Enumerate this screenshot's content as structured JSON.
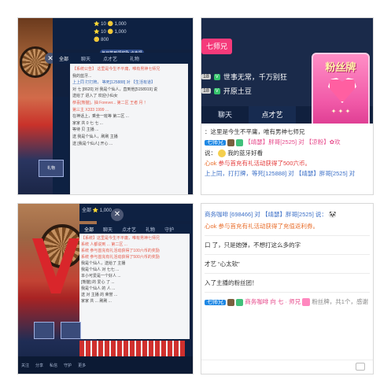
{
  "panelA": {
    "topbar": {
      "line1": "⭐  10   🪙 1,000",
      "line2": "⭐  10   🪙 1,000",
      "line3": "🪙 800"
    },
    "close": "✕",
    "promo_text": "每日签到领奖励\n点击领取",
    "tabs": [
      "全部",
      "聊天",
      "点才艺",
      "礼物"
    ],
    "chat": [
      "【系统公告】 这里是今生不平庸，唯有男神七师兄",
      "我的蓝牙...",
      "上上同 打打牌， 等死[125888] 对 【生活有道】",
      "对 七 [8620] 对 我是个仙人，直到他[5158919] 说",
      "送给了 进入了  欢迎小仙女",
      "恭喜[熊猫]，抽 Forever... 第二区 王者 月 ！",
      "第三主 X333 1999 ...",
      "在神话上，乘坐一班等 第二区 ...",
      "家家 共 0 七 七 ...",
      "等待 贝 主播 ...",
      "送 我是个仙人，刷刷 主播",
      "送 [我是个仙人] 开心 ..."
    ],
    "gift_label": "礼物"
  },
  "panelB": {
    "rank_badge": "七师兄",
    "header_lines": [
      {
        "lvl": "18",
        "text": "世事无常，千万别狂"
      },
      {
        "lvl": "18",
        "text": "开原土豆"
      }
    ],
    "tabs": [
      "聊天",
      "点才艺",
      "礼"
    ],
    "fans_title": "粉丝牌",
    "fans_stars": "✦ ✦ ✦",
    "chat": {
      "line1": "：这里是今生不平庸，唯有男神七师兄",
      "line2_tag": "七师兄",
      "line2_user": "【靖瑟】胖哥[2525] 对 【凉粉】✿欢",
      "line3": "说：",
      "line3b": "我的蓝牙好看",
      "line4_prefix": "心ok",
      "line4": "参与首充有礼活动获得了500六币。",
      "line5": "上上同，打打牌，等死[125888] 对 【靖瑟】胖哥[2525] 对"
    }
  },
  "panelC": {
    "topbar_text": "全部  ⭐  1,000",
    "close": "✕",
    "promo_text": "每日签到",
    "tabs": [
      "全部",
      "聊天",
      "点才艺",
      "礼物",
      "守护"
    ],
    "chat": [
      "【系统】这里是今生不平庸，唯有男神七师兄",
      "系统 人都说到 ... 第二区  ...",
      "系统  参与首充有礼活动获得了100六币的奖励",
      "系统  参与首充有礼活动获得了500六币的奖励",
      "我是个仙人，送给了 主播",
      "我是个仙人 对 七七 ...",
      "本小可爱是一个好人 ...",
      "[熊猫]  的 爱心 了 ...",
      "我是个仙人 的 人 ...",
      "送 对 主播 的 荣誉 ...",
      "家家 共 ... 刷刷 ..."
    ],
    "bottom_tabs": [
      "关注",
      "分享",
      "私信",
      "守护",
      "更多"
    ]
  },
  "panelD": {
    "chat": [
      {
        "type": "mixed",
        "a": "商务咖啡 [698466] 对 【靖瑟】胖哥[2525] 说：",
        "emoji": "🐼"
      },
      {
        "type": "mixed",
        "a": "心ok 参与首充有礼活动获得了充值返利券。"
      },
      {
        "type": "plain",
        "a": "口 了，只是她弹，不想打这么多的字"
      },
      {
        "type": "plain",
        "a": "才艺 “心太软”"
      },
      {
        "type": "plain",
        "a": "入了主播的粉丝团！"
      },
      {
        "type": "fan",
        "tag": "七师兄",
        "user": "商务咖啡 向 七 · 师兄",
        "gift": "粉丝牌，共1个，感谢"
      }
    ]
  }
}
